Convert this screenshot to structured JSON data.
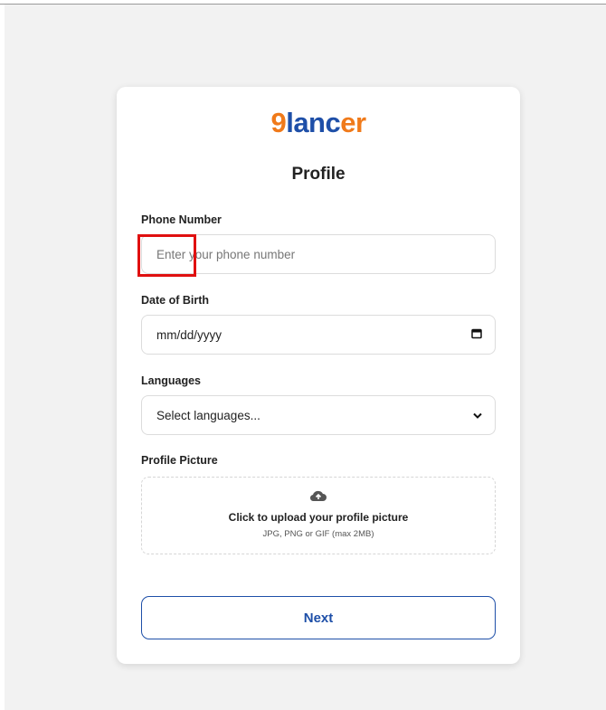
{
  "brand": {
    "nine": "9",
    "lanc": "lanc",
    "er": "er"
  },
  "form": {
    "title": "Profile",
    "phone": {
      "label": "Phone Number",
      "placeholder": "Enter your phone number"
    },
    "dob": {
      "label": "Date of Birth",
      "value": "mm/dd/yyyy",
      "icon": "calendar-icon"
    },
    "languages": {
      "label": "Languages",
      "value": "Select languages...",
      "icon": "chevron-down-icon"
    },
    "picture": {
      "label": "Profile Picture",
      "icon": "cloud-upload-icon",
      "cta": "Click to upload your profile picture",
      "hint": "JPG, PNG or GIF (max 2MB)"
    },
    "next_label": "Next"
  },
  "colors": {
    "brand_blue": "#1e4fa8",
    "brand_orange": "#f07a1a",
    "highlight": "#e01010"
  }
}
